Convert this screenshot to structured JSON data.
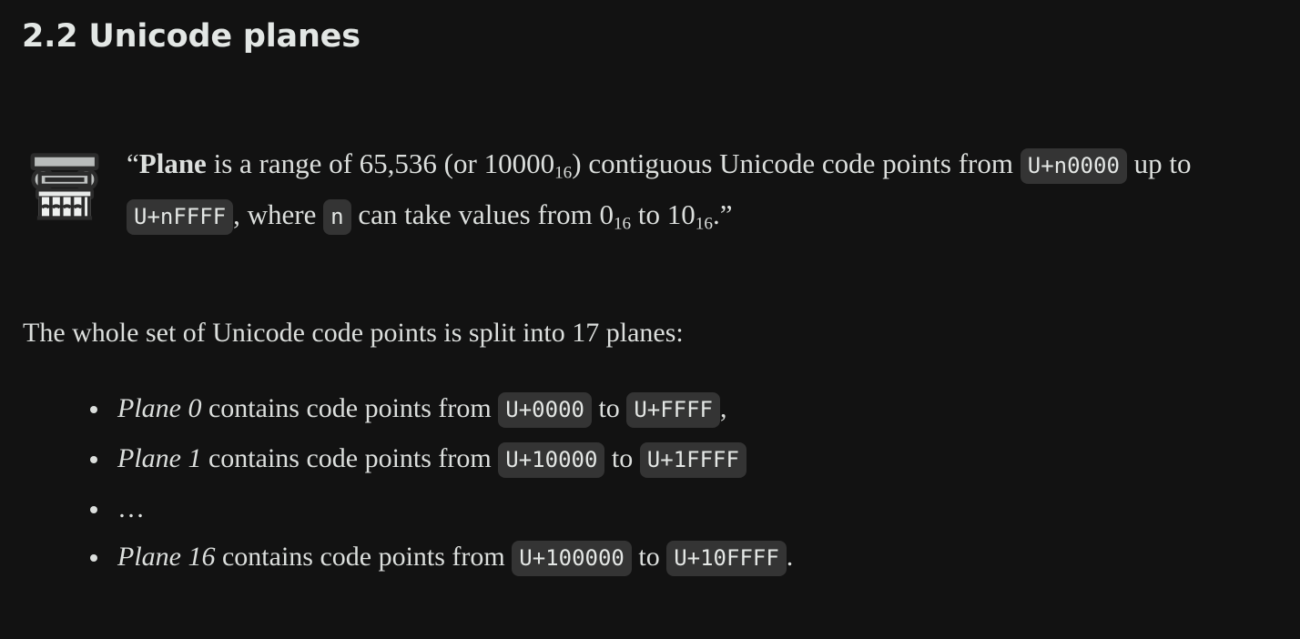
{
  "theme": {
    "background": "#121212",
    "text_color": "#dcdfdd",
    "heading_color": "#e3e7e5",
    "code_background": "#343434",
    "code_color": "#e4e7e5"
  },
  "heading": {
    "text": "2.2 Unicode planes"
  },
  "quote": {
    "icon": "classical-column-icon",
    "open_quote": "“",
    "term": "Plane",
    "part1": " is a range of 65,536 (or 10000",
    "sub1": "16",
    "part2": ") contiguous Unicode code points from ",
    "code1": "U+n0000",
    "part3": " up to ",
    "code2": "U+nFFFF",
    "part4": ", where ",
    "code3": "n",
    "part5": " can take values from 0",
    "sub2": "16",
    "part6": " to 10",
    "sub3": "16",
    "part7": ".",
    "close_quote": "”"
  },
  "paragraph": {
    "text": "The whole set of Unicode code points is split into 17 planes:"
  },
  "list": {
    "items": [
      {
        "type": "plane",
        "emphasis": "Plane 0",
        "middle": " contains code points from ",
        "code_from": "U+0000",
        "between": " to ",
        "code_to": "U+FFFF",
        "tail": ","
      },
      {
        "type": "plane",
        "emphasis": "Plane 1",
        "middle": " contains code points from ",
        "code_from": "U+10000",
        "between": " to ",
        "code_to": "U+1FFFF",
        "tail": ""
      },
      {
        "type": "ellipsis",
        "text": "…"
      },
      {
        "type": "plane",
        "emphasis": "Plane 16",
        "middle": " contains code points from ",
        "code_from": "U+100000",
        "between": " to ",
        "code_to": "U+10FFFF",
        "tail": "."
      }
    ]
  }
}
